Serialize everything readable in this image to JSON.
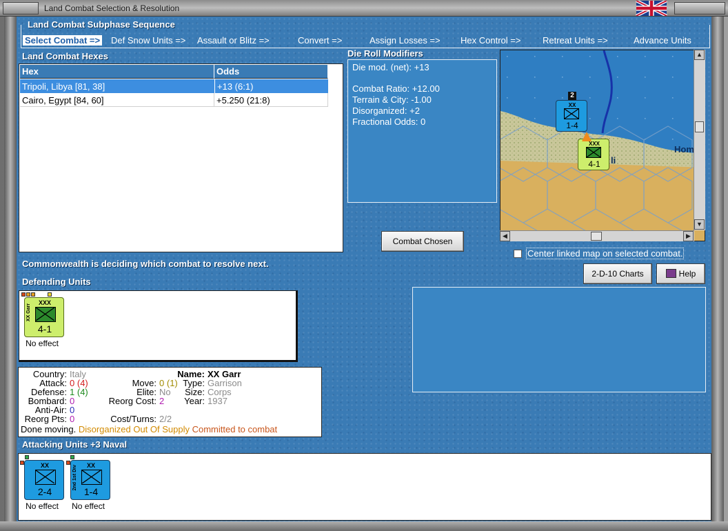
{
  "window": {
    "title": "Land Combat Selection & Resolution",
    "flag_icon": "uk-flag-icon"
  },
  "sequence": {
    "title": "Land Combat Subphase Sequence",
    "steps": [
      "Select Combat =>",
      "Def Snow Units =>",
      "Assault or Blitz =>",
      "Convert =>",
      "Assign Losses =>",
      "Hex Control =>",
      "Retreat Units =>",
      "Advance Units"
    ]
  },
  "hexes": {
    "title": "Land Combat Hexes",
    "columns": [
      "Hex",
      "Odds"
    ],
    "rows": [
      {
        "hex": "Tripoli, Libya [81, 38]",
        "odds": "+13 (6:1)",
        "selected": true
      },
      {
        "hex": "Cairo, Egypt [84, 60]",
        "odds": "+5.250 (21:8)",
        "selected": false
      }
    ]
  },
  "drm": {
    "title": "Die Roll Modifiers",
    "lines": [
      "Die mod. (net): +13",
      "",
      "Combat Ratio: +12.00",
      "Terrain & City: -1.00",
      "Disorganized: +2",
      "Fractional Odds: 0"
    ]
  },
  "map": {
    "label": "Hom",
    "units": [
      {
        "size": "XX",
        "strength": "1-4",
        "stack": "2"
      },
      {
        "size": "XXX",
        "strength": "4-1",
        "stack": ""
      }
    ],
    "city_label": "li"
  },
  "buttons": {
    "combat_chosen": "Combat Chosen",
    "charts": "2-D-10 Charts",
    "help": "Help"
  },
  "center_map_label": "Center linked map on selected combat.",
  "status": "Commonwealth is deciding which combat to resolve next.",
  "defending": {
    "title": "Defending Units",
    "units": [
      {
        "size": "XXX",
        "type_label": "XX Garr",
        "strength": "4-1",
        "result": "No effect"
      }
    ]
  },
  "info": {
    "country_label": "Country:",
    "country": "Italy",
    "attack_label": "Attack:",
    "attack": "0",
    "attack_paren": "(4)",
    "defense_label": "Defense:",
    "defense": "1",
    "defense_paren": "(4)",
    "bombard_label": "Bombard:",
    "bombard": "0",
    "antiair_label": "Anti-Air:",
    "antiair": "0",
    "reorgpts_label": "Reorg Pts:",
    "reorgpts": "0",
    "move_label": "Move:",
    "move": "0",
    "move_paren": "(1)",
    "elite_label": "Elite:",
    "elite": "No",
    "reorgcost_label": "Reorg Cost:",
    "reorgcost": "2",
    "costturns_label": "Cost/Turns:",
    "costturns": "2/2",
    "name_label": "Name:",
    "name": "XX Garr",
    "type_label": "Type:",
    "type": "Garrison",
    "size_label": "Size:",
    "size": "Corps",
    "year_label": "Year:",
    "year": "1937",
    "status_done": "Done moving.",
    "status_flags": "Disorganized Out Of Supply",
    "status_committed": "Committed to combat"
  },
  "attacking": {
    "title": "Attacking Units +3 Naval",
    "units": [
      {
        "size": "XX",
        "type_label": "",
        "strength": "2-4",
        "result": "No effect"
      },
      {
        "size": "XX",
        "type_label": "2nd 1st Div",
        "strength": "1-4",
        "result": "No effect"
      }
    ]
  },
  "colors": {
    "panel_blue": "#3a7bb5",
    "selection": "#3d8ee0",
    "allied_unit": "#1e9be0",
    "axis_unit": "#cdee6c",
    "warning": "#d28a00",
    "committed": "#c8561c"
  }
}
